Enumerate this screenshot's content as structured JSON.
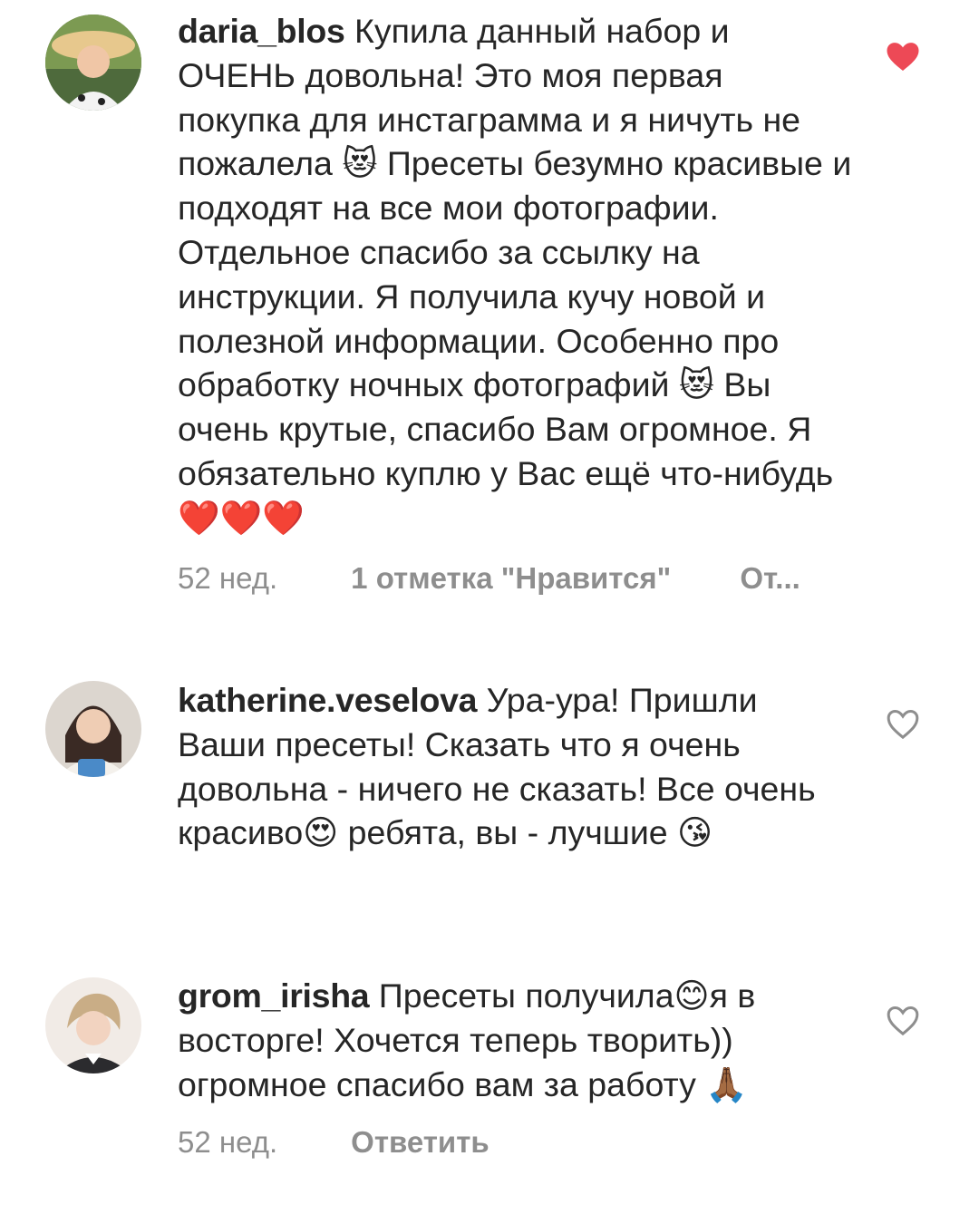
{
  "comments": [
    {
      "username": "daria_blos",
      "text": "Купила данный набор и ОЧЕНЬ довольна! Это моя первая покупка для инстаграмма и я ничуть не пожалела 😻 Пресеты безумно красивые и подходят на все мои фотографии. Отдельное спасибо за ссылку на инструкции. Я получила кучу новой и полезной информации. Особенно про обработку ночных фотографий 😻 Вы очень крутые, спасибо Вам огромное. Я обязательно куплю у Вас ещё что-нибудь ❤️❤️❤️",
      "liked": true,
      "time": "52 нед.",
      "likes": "1 отметка \"Нравится\"",
      "reply": "От..."
    },
    {
      "username": "katherine.veselova",
      "text": "Ура-ура! Пришли Ваши пресеты! Сказать что я очень довольна - ничего не сказать! Все очень красиво😍 ребята, вы - лучшие 😘",
      "liked": false
    },
    {
      "username": "grom_irisha",
      "text": "Пресеты получила😊я в восторге! Хочется теперь творить)) огромное спасибо вам за работу 🙏🏾",
      "liked": false,
      "time": "52 нед.",
      "reply": "Ответить"
    }
  ],
  "colors": {
    "text": "#262626",
    "meta": "#8e8e8e",
    "heart_active": "#ed4956",
    "heart_outline": "#8e8e8e"
  }
}
